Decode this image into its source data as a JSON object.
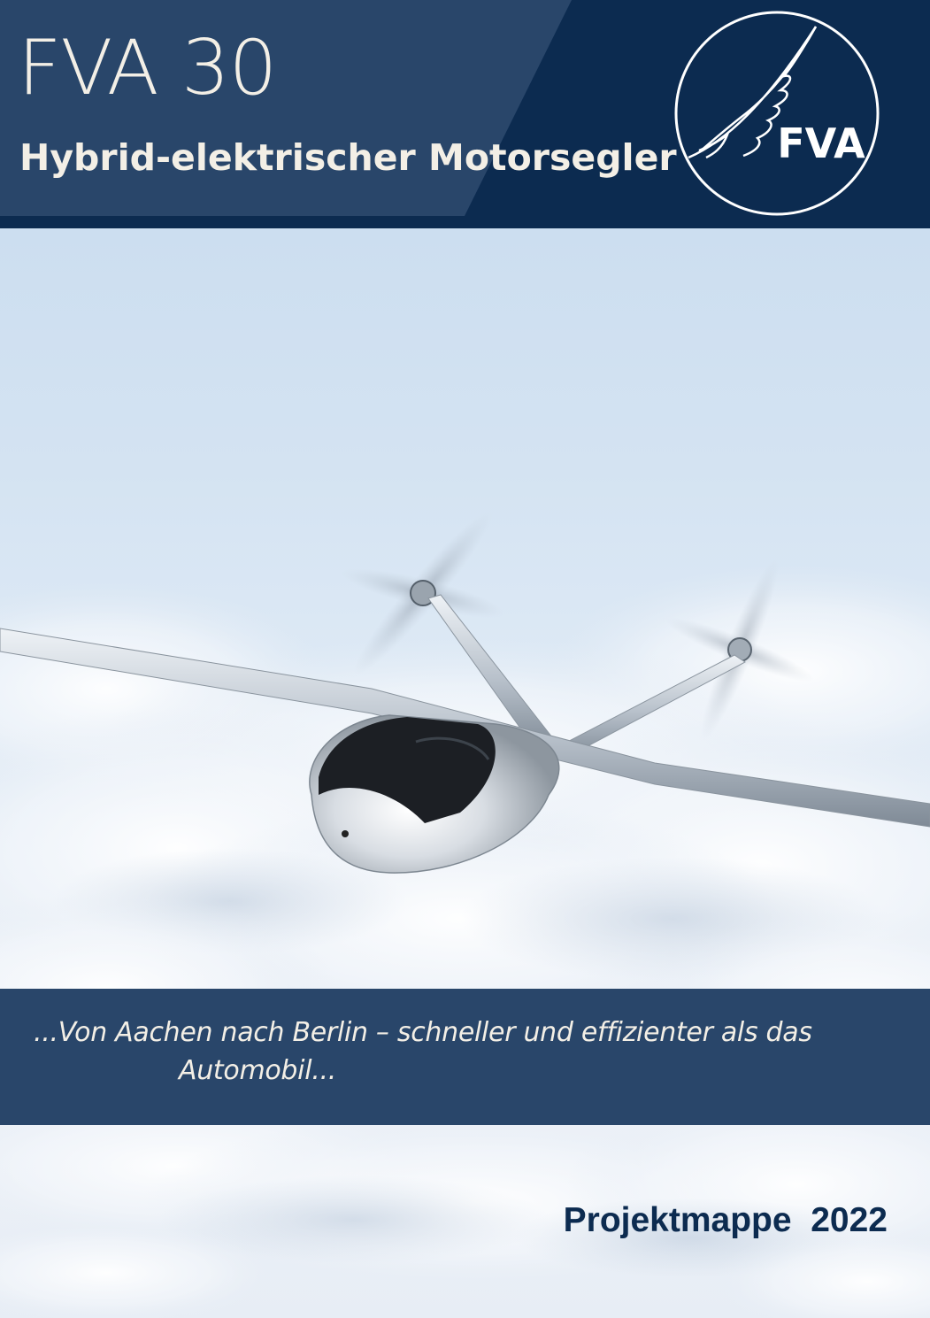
{
  "header": {
    "title": "FVA 30",
    "subtitle": "Hybrid-elektrischer Motorsegler",
    "logo_text": "FVA"
  },
  "caption": {
    "line1": "...Von Aachen nach Berlin – schneller und  effizienter als das",
    "line2": "Automobil..."
  },
  "footer": {
    "title": "Projektmappe  2022"
  },
  "colors": {
    "navy": "#0c2b50",
    "slate_blue": "#29466a",
    "cream_text": "#f3efe6"
  }
}
